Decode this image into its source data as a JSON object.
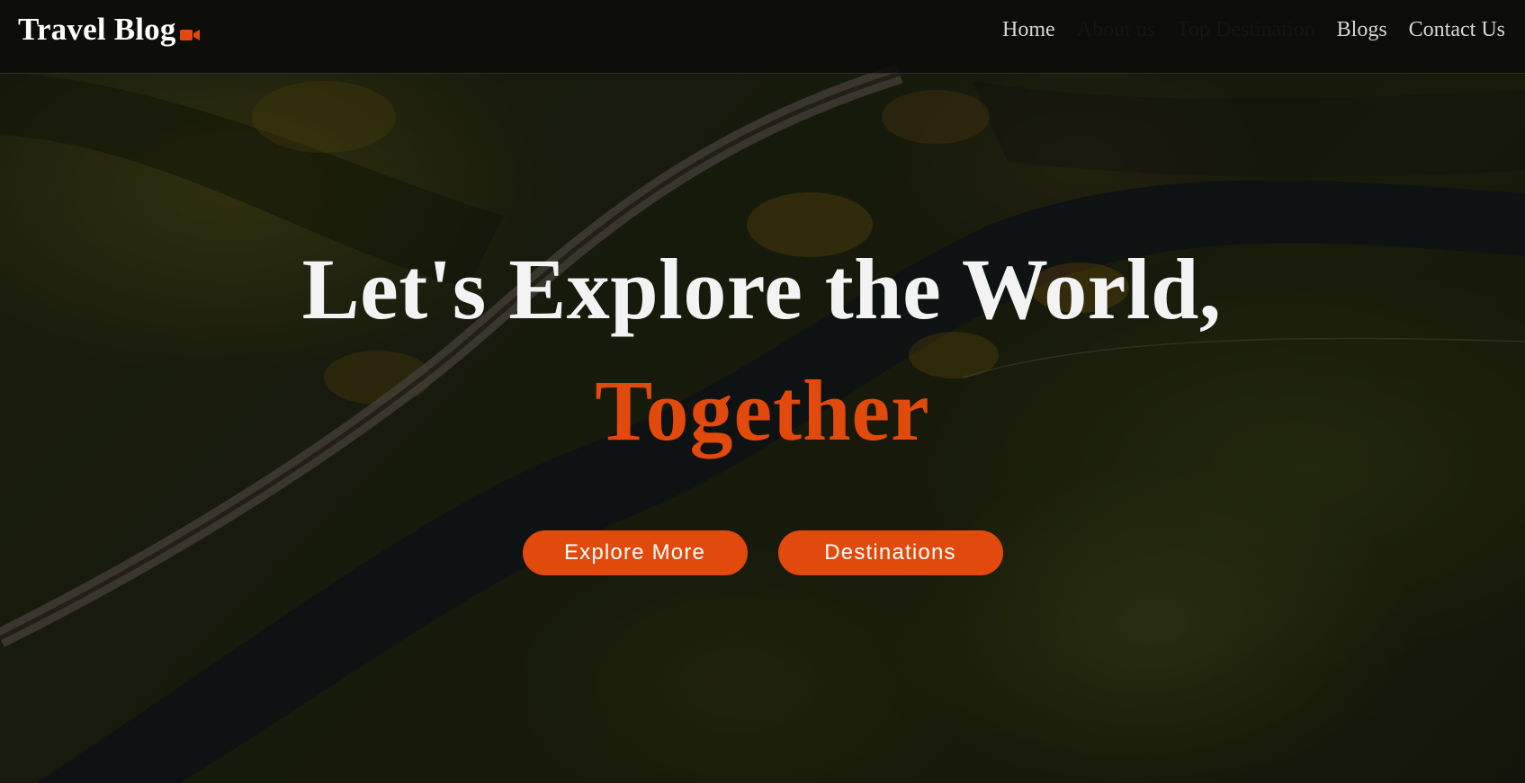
{
  "brand": {
    "name": "Travel Blog",
    "icon": "video-camera-icon",
    "accent_color": "#e2490c"
  },
  "nav": {
    "items": [
      {
        "label": "Home"
      },
      {
        "label": "About us"
      },
      {
        "label": "Top Destination"
      },
      {
        "label": "Blogs"
      },
      {
        "label": "Contact Us"
      }
    ]
  },
  "hero": {
    "title": "Let's Explore the World,",
    "highlight": "Together",
    "buttons": {
      "explore_label": "Explore More",
      "destinations_label": "Destinations"
    }
  },
  "colors": {
    "accent": "#e2490c",
    "header_background": "#0a0a09",
    "title_text": "#f3f3f3"
  }
}
